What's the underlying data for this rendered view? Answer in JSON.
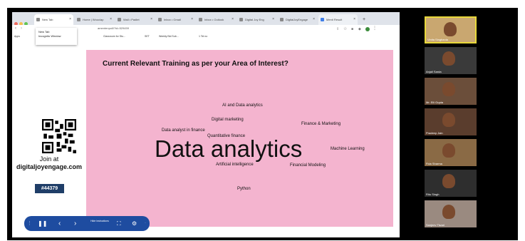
{
  "browser": {
    "tabs": [
      {
        "label": "New Tab",
        "active": true
      },
      {
        "label": "Home | Wooclap",
        "active": false
      },
      {
        "label": "Wall • Padlet",
        "active": false
      },
      {
        "label": "Inbox • Gmail",
        "active": false
      },
      {
        "label": "Inbox • Outlook",
        "active": false
      },
      {
        "label": "Digital Joy Eng",
        "active": false
      },
      {
        "label": "DigitalJoyEngage",
        "active": false
      },
      {
        "label": "Menti Result",
        "active": false
      }
    ],
    "new_tab_symbol": "+",
    "url": "amentenpoll/?id=529459",
    "bookmarks": [
      "Apps",
      "Classroom for Stu...",
      "SET",
      "Weekly Bid Sub...",
      "1 Tel no"
    ],
    "dropdown": {
      "items": [
        "New Tab",
        "Incognito Window"
      ]
    }
  },
  "slide": {
    "question": "Current Relevant Training as per your Area of Interest?",
    "background_color": "#f4b4cf",
    "words": [
      {
        "text": "Data analytics",
        "weight": 10
      },
      {
        "text": "AI and Data analytics",
        "weight": 2
      },
      {
        "text": "Digital marketing",
        "weight": 2
      },
      {
        "text": "Finance & Marketing",
        "weight": 2
      },
      {
        "text": "Data analyst in finance",
        "weight": 2
      },
      {
        "text": "Quantitative finance",
        "weight": 2
      },
      {
        "text": "Machine Learning",
        "weight": 2
      },
      {
        "text": "Artificial intelligence",
        "weight": 2
      },
      {
        "text": "Financial Modeling",
        "weight": 2
      },
      {
        "text": "Python",
        "weight": 2
      }
    ]
  },
  "join": {
    "label": "Join at",
    "url": "digitaljoyengage.com",
    "code": "#44379"
  },
  "presenter_controls": {
    "pause_icon": "pause-icon",
    "prev_icon": "chevron-left-icon",
    "next_icon": "chevron-right-icon",
    "hide_label": "Hide instructions",
    "fullscreen_icon": "fullscreen-icon",
    "settings_icon": "settings-icon"
  },
  "participants": [
    {
      "name": "Vinita Singhania",
      "bg": "#c9a770",
      "highlight": true
    },
    {
      "name": "Anjali Sarda",
      "bg": "#3a3a3a",
      "highlight": false
    },
    {
      "name": "Mr. Elli Gupta",
      "bg": "#6b4e3a",
      "highlight": false
    },
    {
      "name": "Pradeep Jain",
      "bg": "#5a3d2d",
      "highlight": false
    },
    {
      "name": "Fida Sharma",
      "bg": "#8a6a45",
      "highlight": false
    },
    {
      "name": "Ritu Singh",
      "bg": "#2e2e2e",
      "highlight": false
    },
    {
      "name": "Sanjeev Tiwari",
      "bg": "#9a8a80",
      "highlight": false
    }
  ],
  "colors": {
    "accent_green": "#e8d83a",
    "join_code_bg": "#1f3e68",
    "controls_bg": "#1e4ca0"
  }
}
